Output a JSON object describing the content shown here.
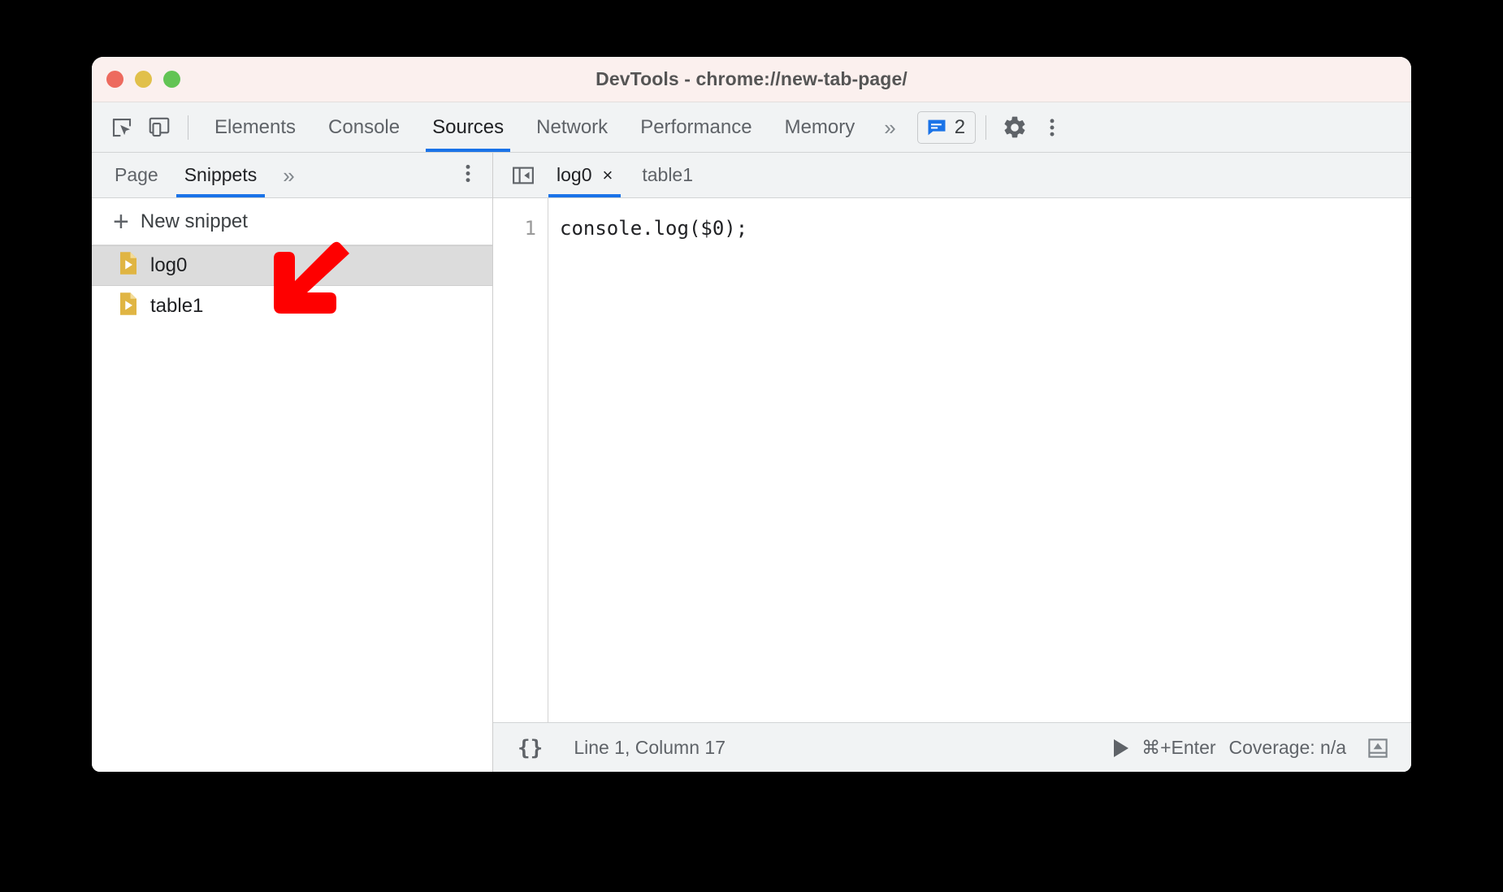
{
  "window": {
    "title": "DevTools - chrome://new-tab-page/",
    "traffic_lights": [
      "close",
      "minimize",
      "maximize"
    ],
    "colors": {
      "titlebar_bg": "#fbf0ee",
      "close": "#ed6a5e",
      "minimize": "#e1c04a",
      "maximize": "#62c454",
      "accent": "#1a73e8",
      "toolbar_bg": "#f1f3f4",
      "selection_bg": "#dcdcdc",
      "snippet_icon": "#e0b543",
      "annotation": "#fe0000"
    }
  },
  "toolbar": {
    "icons": [
      {
        "name": "inspect-element-icon",
        "label": "Inspect element"
      },
      {
        "name": "device-toolbar-icon",
        "label": "Toggle device toolbar"
      }
    ],
    "tabs": [
      {
        "label": "Elements",
        "active": false
      },
      {
        "label": "Console",
        "active": false
      },
      {
        "label": "Sources",
        "active": true
      },
      {
        "label": "Network",
        "active": false
      },
      {
        "label": "Performance",
        "active": false
      },
      {
        "label": "Memory",
        "active": false
      }
    ],
    "more_tabs": "»",
    "issues_count": "2",
    "settings_label": "Settings",
    "kebab_label": "Customize and control DevTools"
  },
  "navigator": {
    "tabs": [
      {
        "label": "Page",
        "active": false
      },
      {
        "label": "Snippets",
        "active": true
      }
    ],
    "more_tabs": "»",
    "kebab_label": "More options",
    "new_snippet": {
      "plus": "+",
      "label": "New snippet"
    },
    "snippets": [
      {
        "label": "log0",
        "selected": true
      },
      {
        "label": "table1",
        "selected": false
      }
    ]
  },
  "editor": {
    "collapse_label": "Hide navigator",
    "tabs": [
      {
        "label": "log0",
        "active": true,
        "closable": true,
        "close_glyph": "×"
      },
      {
        "label": "table1",
        "active": false,
        "closable": false,
        "close_glyph": ""
      }
    ],
    "lines": [
      {
        "number": "1",
        "text": "console.log($0);"
      }
    ]
  },
  "statusbar": {
    "pretty_print": "{}",
    "cursor_position": "Line 1, Column 17",
    "run_shortcut": "⌘+Enter",
    "coverage": "Coverage: n/a",
    "drawer_label": "Show console drawer"
  },
  "annotation": {
    "type": "arrow",
    "direction": "down-left",
    "color": "#fe0000",
    "points_at": "snippet log0"
  }
}
